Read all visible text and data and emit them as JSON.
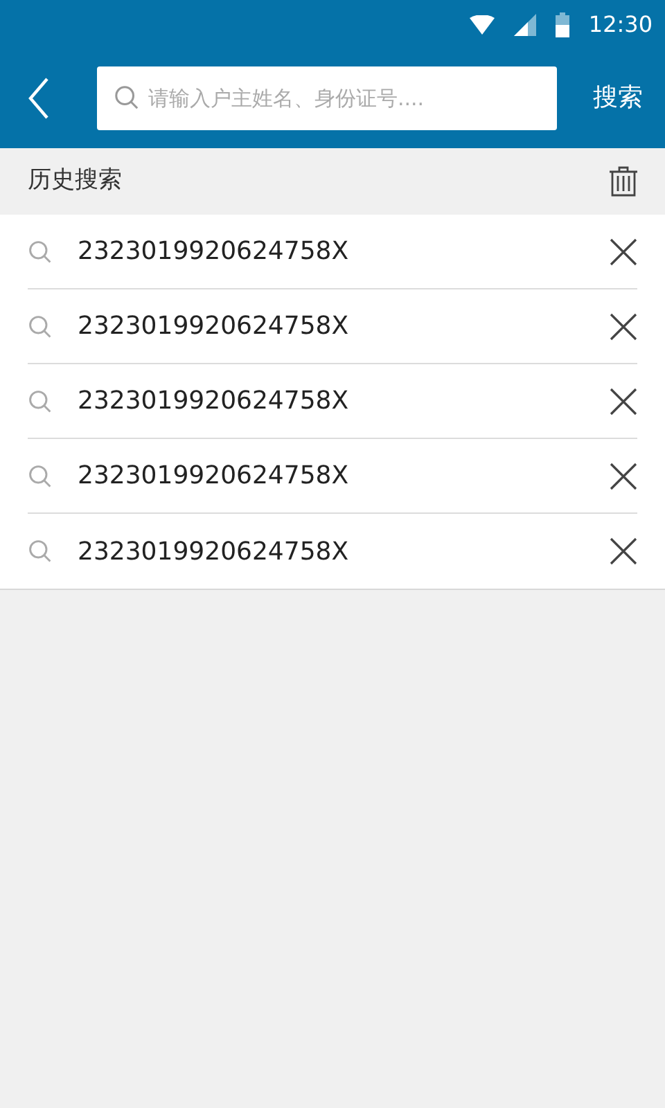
{
  "status_bar": {
    "time": "12:30"
  },
  "search_bar": {
    "placeholder": "请输入户主姓名、身份证号....",
    "button": "搜索"
  },
  "history": {
    "title": "历史搜索",
    "items": [
      {
        "text": "2323019920624758X"
      },
      {
        "text": "2323019920624758X"
      },
      {
        "text": "2323019920624758X"
      },
      {
        "text": "2323019920624758X"
      },
      {
        "text": "2323019920624758X"
      }
    ]
  }
}
